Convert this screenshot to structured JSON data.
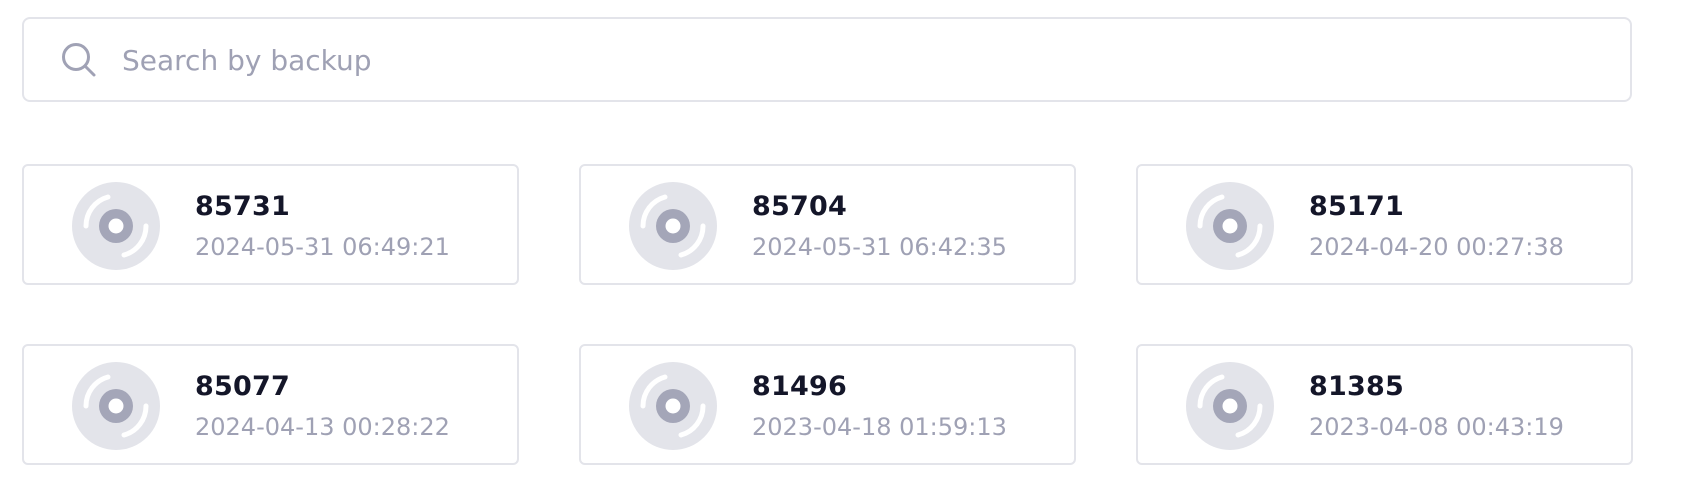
{
  "search": {
    "placeholder": "Search by backup",
    "value": "",
    "icon": "search-icon"
  },
  "colors": {
    "border": "#e3e4ea",
    "title": "#141629",
    "muted": "#9fa1b4",
    "disc_fill": "#e3e4ea",
    "disc_center": "#a4a6b8"
  },
  "backups": [
    {
      "name": "85731",
      "date": "2024-05-31 06:49:21",
      "icon": "disc-icon"
    },
    {
      "name": "85704",
      "date": "2024-05-31 06:42:35",
      "icon": "disc-icon"
    },
    {
      "name": "85171",
      "date": "2024-04-20 00:27:38",
      "icon": "disc-icon"
    },
    {
      "name": "85077",
      "date": "2024-04-13 00:28:22",
      "icon": "disc-icon"
    },
    {
      "name": "81496",
      "date": "2023-04-18 01:59:13",
      "icon": "disc-icon"
    },
    {
      "name": "81385",
      "date": "2023-04-08 00:43:19",
      "icon": "disc-icon"
    }
  ]
}
